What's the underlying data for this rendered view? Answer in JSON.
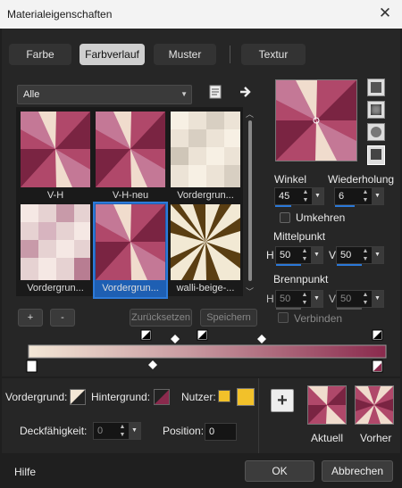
{
  "window": {
    "title": "Materialeigenschaften",
    "close_glyph": "✕"
  },
  "tabs": [
    {
      "label": "Farbe",
      "active": false
    },
    {
      "label": "Farbverlauf",
      "active": true
    },
    {
      "label": "Muster",
      "active": false
    },
    {
      "label": "Textur",
      "active": false
    }
  ],
  "category_select": {
    "value": "Alle"
  },
  "gradients": [
    {
      "label": "V-H",
      "style": "pink-swirl",
      "selected": false
    },
    {
      "label": "V-H-neu",
      "style": "pink-swirl",
      "selected": false
    },
    {
      "label": "Vordergrun...",
      "style": "beige-checker",
      "selected": false
    },
    {
      "label": "Vordergrun...",
      "style": "pink-checker",
      "selected": false
    },
    {
      "label": "Vordergrun...",
      "style": "pink-swirl",
      "selected": true
    },
    {
      "label": "walli-beige-...",
      "style": "brown-burst",
      "selected": false
    }
  ],
  "list_buttons": {
    "add": "+",
    "remove": "-",
    "reset": "Zurücksetzen",
    "save": "Speichern"
  },
  "angle": {
    "label": "Winkel",
    "value": "45"
  },
  "repeat": {
    "label": "Wiederholung",
    "value": "6"
  },
  "invert": {
    "label": "Umkehren",
    "checked": false
  },
  "center": {
    "label": "Mittelpunkt",
    "h_label": "H",
    "h_value": "50",
    "v_label": "V",
    "v_value": "50"
  },
  "focal": {
    "label": "Brennpunkt",
    "h_label": "H",
    "h_value": "50",
    "v_label": "V",
    "v_value": "50"
  },
  "link": {
    "label": "Verbinden",
    "checked": false
  },
  "bottom": {
    "foreground_label": "Vordergrund:",
    "background_label": "Hintergrund:",
    "user_label": "Nutzer:",
    "opacity_label": "Deckfähigkeit:",
    "opacity_value": "0",
    "position_label": "Position:",
    "position_value": "0",
    "add_glyph": "+",
    "current_label": "Aktuell",
    "previous_label": "Vorher"
  },
  "footer": {
    "help": "Hilfe",
    "ok": "OK",
    "cancel": "Abbrechen"
  },
  "colors": {
    "gradient_start": "#f3e7d6",
    "gradient_end": "#8a2a4d",
    "user_color": "#f2c12a",
    "accent": "#2b78d8"
  }
}
